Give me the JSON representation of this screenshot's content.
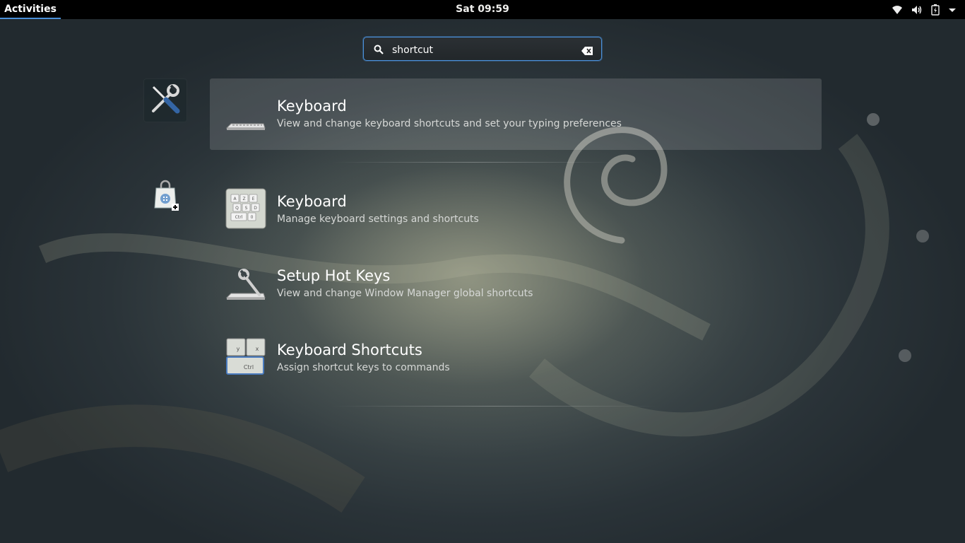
{
  "topbar": {
    "activities_label": "Activities",
    "clock": "Sat 09:59",
    "status_icons": [
      "wifi-icon",
      "volume-icon",
      "battery-icon",
      "chevron-down-icon"
    ]
  },
  "search": {
    "value": "shortcut",
    "search_icon": "search-icon",
    "clear_icon": "clear-icon"
  },
  "providers": [
    {
      "name": "settings",
      "icon": "tools-icon"
    },
    {
      "name": "software",
      "icon": "software-bag-icon"
    }
  ],
  "results": [
    {
      "title": "Keyboard",
      "description": "View and change keyboard shortcuts and set your typing preferences",
      "icon": "keyboard-icon",
      "selected": true
    },
    {
      "title": "Keyboard",
      "description": "Manage keyboard settings and shortcuts",
      "icon": "keyboard-keys-icon"
    },
    {
      "title": "Setup Hot Keys",
      "description": "View and change Window Manager global shortcuts",
      "icon": "hotkeys-icon"
    },
    {
      "title": "Keyboard Shortcuts",
      "description": "Assign shortcut keys to commands",
      "icon": "keyboard-shortcuts-icon"
    }
  ],
  "icon_key_labels": {
    "keys_grid": [
      "A",
      "Z",
      "E",
      "Q",
      "S",
      "D",
      "Ctrl",
      "0"
    ],
    "shortcuts": [
      "y",
      "x",
      "Ctrl"
    ]
  },
  "colors": {
    "accent": "#4a90d9",
    "topbar": "#000000"
  }
}
